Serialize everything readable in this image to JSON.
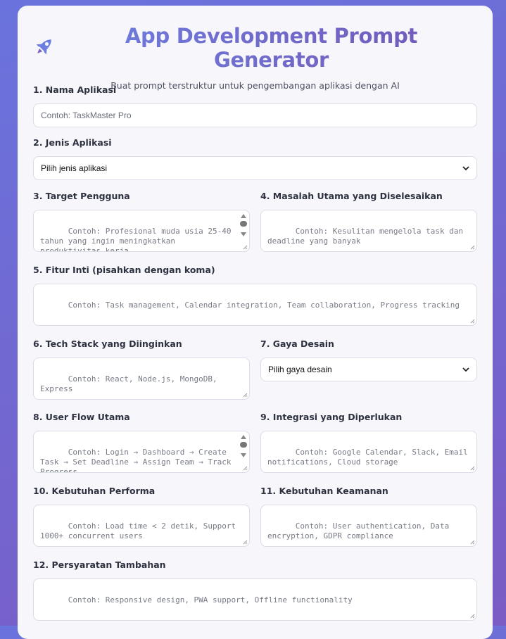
{
  "header": {
    "title": "App Development Prompt Generator",
    "subtitle": "Buat prompt terstruktur untuk pengembangan aplikasi dengan AI",
    "icon": "rocket-icon",
    "accent": "#6d7ee0"
  },
  "fields": {
    "app_name": {
      "label": "1. Nama Aplikasi",
      "placeholder": "Contoh: TaskMaster Pro"
    },
    "app_type": {
      "label": "2. Jenis Aplikasi",
      "selected": "Pilih jenis aplikasi"
    },
    "target_users": {
      "label": "3. Target Pengguna",
      "placeholder": "Contoh: Profesional muda usia 25-40 tahun yang ingin meningkatkan produktivitas kerja"
    },
    "main_problem": {
      "label": "4. Masalah Utama yang Diselesaikan",
      "placeholder": "Contoh: Kesulitan mengelola task dan deadline yang banyak"
    },
    "core_features": {
      "label": "5. Fitur Inti (pisahkan dengan koma)",
      "placeholder": "Contoh: Task management, Calendar integration, Team collaboration, Progress tracking"
    },
    "tech_stack": {
      "label": "6. Tech Stack yang Diinginkan",
      "placeholder": "Contoh: React, Node.js, MongoDB, Express"
    },
    "design_style": {
      "label": "7. Gaya Desain",
      "selected": "Pilih gaya desain"
    },
    "user_flow": {
      "label": "8. User Flow Utama",
      "placeholder": "Contoh: Login → Dashboard → Create Task → Set Deadline → Assign Team → Track Progress"
    },
    "integrations": {
      "label": "9. Integrasi yang Diperlukan",
      "placeholder": "Contoh: Google Calendar, Slack, Email notifications, Cloud storage"
    },
    "performance": {
      "label": "10. Kebutuhan Performa",
      "placeholder": "Contoh: Load time < 2 detik, Support 1000+ concurrent users"
    },
    "security": {
      "label": "11. Kebutuhan Keamanan",
      "placeholder": "Contoh: User authentication, Data encryption, GDPR compliance"
    },
    "extra": {
      "label": "12. Persyaratan Tambahan",
      "placeholder": "Contoh: Responsive design, PWA support, Offline functionality"
    }
  }
}
